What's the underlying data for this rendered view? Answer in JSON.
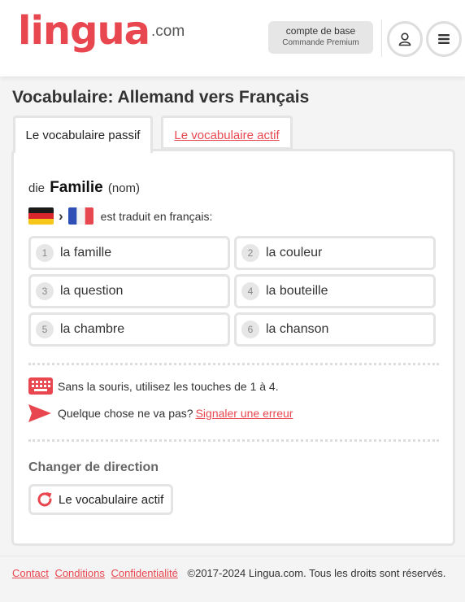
{
  "header": {
    "logo_main": "lingua",
    "logo_suffix": ".com",
    "account_line1": "compte de base",
    "account_line2": "Commande Premium",
    "user_icon": "user-icon",
    "menu_icon": "hamburger-menu-icon"
  },
  "page_title": "Vocabulaire: Allemand vers Français",
  "tabs": [
    {
      "label": "Le vocabulaire passif",
      "selected": true
    },
    {
      "label": "Le vocabulaire actif",
      "selected": false
    }
  ],
  "question": {
    "prefix": "die",
    "word": "Familie",
    "pos": "(nom)",
    "translate_text": "est traduit en français:",
    "from_flag": "german-flag-icon",
    "to_flag": "french-flag-icon"
  },
  "answers": [
    {
      "num": "1",
      "text": "la famille"
    },
    {
      "num": "2",
      "text": "la couleur"
    },
    {
      "num": "3",
      "text": "la question"
    },
    {
      "num": "4",
      "text": "la bouteille"
    },
    {
      "num": "5",
      "text": "la chambre"
    },
    {
      "num": "6",
      "text": "la chanson"
    }
  ],
  "hints": {
    "keyboard_text": "Sans la souris, utilisez les touches de 1 à 4.",
    "report_text": "Quelque chose ne va pas?",
    "report_link": "Signaler une erreur"
  },
  "direction": {
    "title": "Changer de direction",
    "button_label": "Le vocabulaire actif"
  },
  "footer": {
    "links": [
      "Contact",
      "Conditions",
      "Confidentialité"
    ],
    "copyright": "©2017-2024 Lingua.com. Tous les droits sont réservés."
  },
  "colors": {
    "accent": "#e8474f",
    "border": "#e4e4e4",
    "background": "#f4f4f4"
  }
}
